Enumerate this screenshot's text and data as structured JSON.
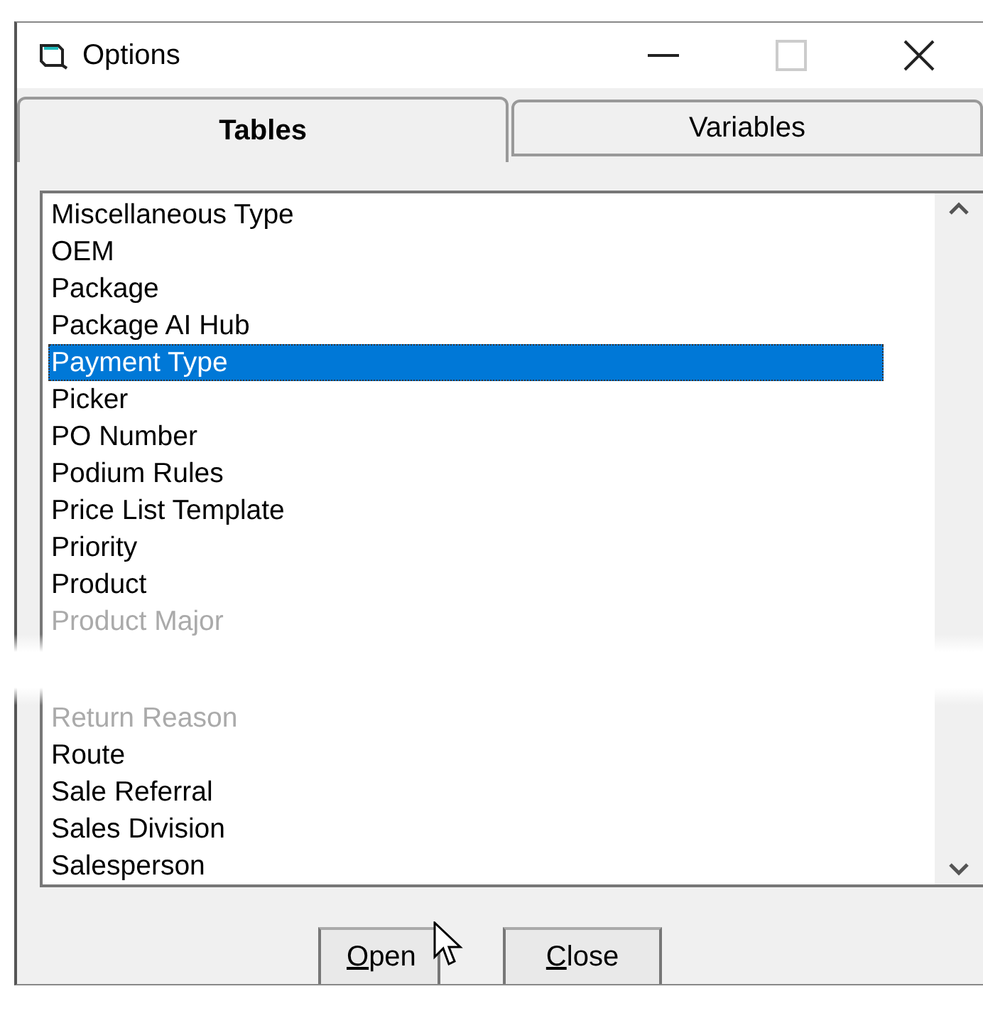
{
  "window": {
    "title": "Options"
  },
  "tabs": [
    {
      "label": "Tables",
      "selected": true
    },
    {
      "label": "Variables",
      "selected": false
    }
  ],
  "list": {
    "sections": [
      {
        "items": [
          {
            "label": "Miscellaneous Type",
            "selected": false,
            "faded": false
          },
          {
            "label": "OEM",
            "selected": false,
            "faded": false
          },
          {
            "label": "Package",
            "selected": false,
            "faded": false
          },
          {
            "label": "Package AI Hub",
            "selected": false,
            "faded": false
          },
          {
            "label": "Payment Type",
            "selected": true,
            "faded": false
          },
          {
            "label": "Picker",
            "selected": false,
            "faded": false
          },
          {
            "label": "PO Number",
            "selected": false,
            "faded": false
          },
          {
            "label": "Podium Rules",
            "selected": false,
            "faded": false
          },
          {
            "label": "Price List Template",
            "selected": false,
            "faded": false
          },
          {
            "label": "Priority",
            "selected": false,
            "faded": false
          },
          {
            "label": "Product",
            "selected": false,
            "faded": false
          },
          {
            "label": "Product Major",
            "selected": false,
            "faded": true
          }
        ]
      },
      {
        "items": [
          {
            "label": "Return Reason",
            "selected": false,
            "faded": true
          },
          {
            "label": "Route",
            "selected": false,
            "faded": false
          },
          {
            "label": "Sale Referral",
            "selected": false,
            "faded": false
          },
          {
            "label": "Sales Division",
            "selected": false,
            "faded": false
          },
          {
            "label": "Salesperson",
            "selected": false,
            "faded": false
          }
        ]
      }
    ]
  },
  "buttons": [
    {
      "label": "Open"
    },
    {
      "label": "Close"
    }
  ]
}
